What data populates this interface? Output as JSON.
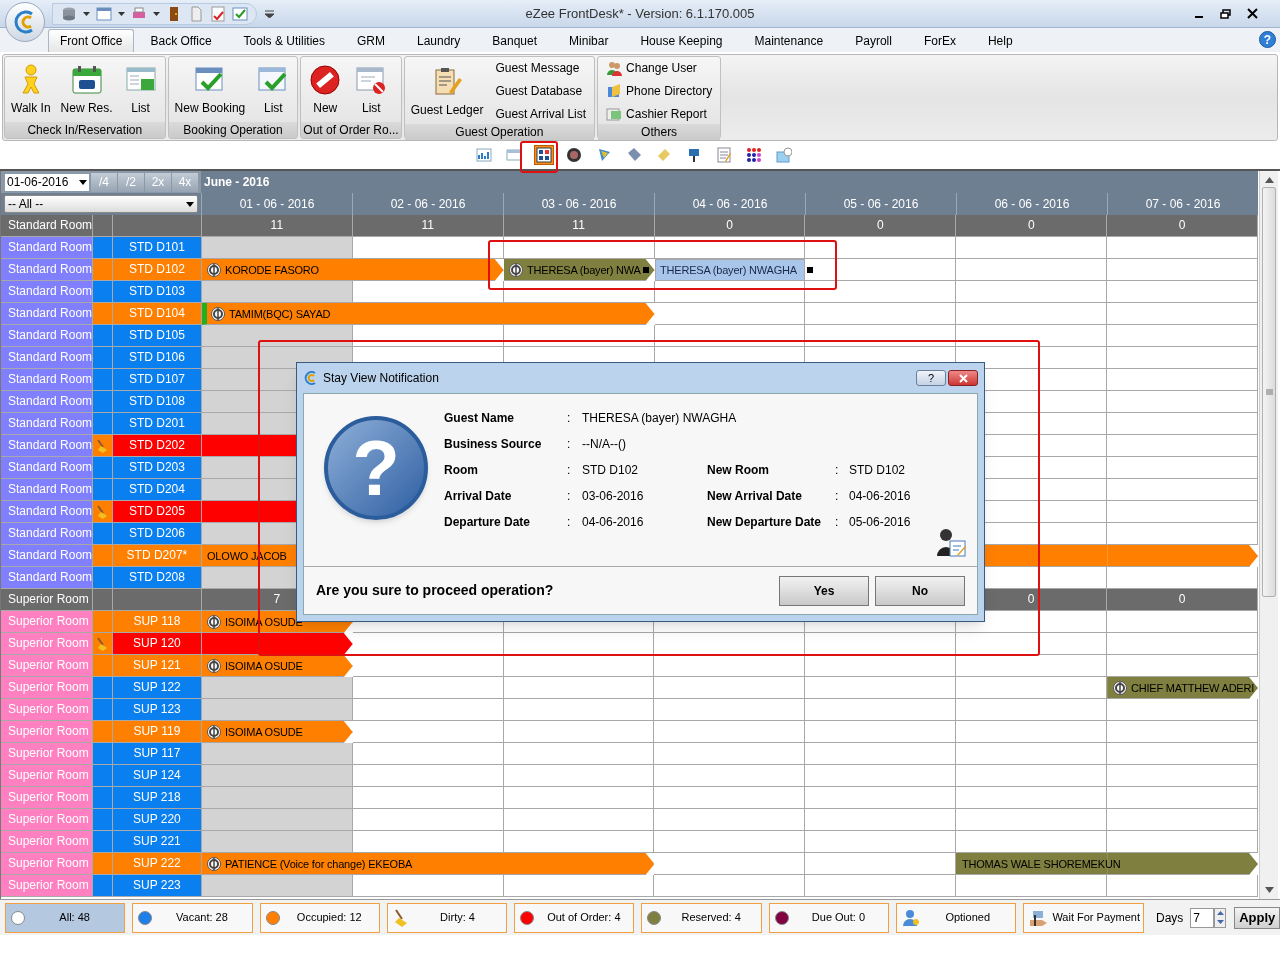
{
  "window": {
    "title": "eZee FrontDesk* - Version: 6.1.170.005"
  },
  "menu": {
    "tabs": [
      {
        "label": "Front Office",
        "selected": true
      },
      {
        "label": "Back Office",
        "selected": false
      },
      {
        "label": "Tools & Utilities",
        "selected": false
      },
      {
        "label": "GRM",
        "selected": false
      },
      {
        "label": "Laundry",
        "selected": false
      },
      {
        "label": "Banquet",
        "selected": false
      },
      {
        "label": "Minibar",
        "selected": false
      },
      {
        "label": "House Keeping",
        "selected": false
      },
      {
        "label": "Maintenance",
        "selected": false
      },
      {
        "label": "Payroll",
        "selected": false
      },
      {
        "label": "ForEx",
        "selected": false
      },
      {
        "label": "Help",
        "selected": false
      }
    ],
    "help_button": "?"
  },
  "ribbon": [
    {
      "label": "Check In/Reservation",
      "buttons": [
        {
          "label": "Walk In",
          "kind": "large"
        },
        {
          "label": "New Res.",
          "kind": "large"
        },
        {
          "label": "List",
          "kind": "large"
        }
      ]
    },
    {
      "label": "Booking Operation",
      "buttons": [
        {
          "label": "New Booking",
          "kind": "large"
        },
        {
          "label": "List",
          "kind": "large"
        }
      ]
    },
    {
      "label": "Out of Order Ro...",
      "buttons": [
        {
          "label": "New",
          "kind": "large"
        },
        {
          "label": "List",
          "kind": "large"
        }
      ]
    },
    {
      "label": "Guest Operation",
      "buttons": [
        {
          "label": "Guest Ledger",
          "kind": "large"
        },
        {
          "label": "Guest Message",
          "kind": "small"
        },
        {
          "label": "Guest Database",
          "kind": "small"
        },
        {
          "label": "Guest Arrival List",
          "kind": "small"
        }
      ]
    },
    {
      "label": "Others",
      "buttons": [
        {
          "label": "Change User",
          "kind": "small_icon"
        },
        {
          "label": "Phone Directory",
          "kind": "small_icon"
        },
        {
          "label": "Cashier Report",
          "kind": "small_icon"
        }
      ]
    }
  ],
  "view_toolbar": [
    {
      "selected": false
    },
    {
      "selected": false
    },
    {
      "selected": true
    },
    {
      "selected": false
    },
    {
      "selected": false
    },
    {
      "selected": false
    },
    {
      "selected": false
    },
    {
      "selected": false
    },
    {
      "selected": false
    },
    {
      "selected": false
    },
    {
      "selected": false
    }
  ],
  "stay_view": {
    "date": "01-06-2016",
    "zoom_buttons": [
      "/4",
      "/2",
      "2x",
      "4x"
    ],
    "month": "June - 2016",
    "filter": "-- All --",
    "dates": [
      "01 - 06 - 2016",
      "02 - 06 - 2016",
      "03 - 06 - 2016",
      "04 - 06 - 2016",
      "05 - 06 - 2016",
      "06 - 06 - 2016",
      "07 - 06 - 2016"
    ],
    "groups": [
      {
        "name": "Standard Room",
        "color": "#8080ff",
        "counts": [
          {
            "kind": "count",
            "value": "11"
          },
          {
            "kind": "count",
            "value": "11"
          },
          {
            "kind": "count",
            "value": "11"
          },
          {
            "kind": "count",
            "value": "0"
          },
          {
            "kind": "count",
            "value": "0"
          },
          {
            "kind": "count",
            "value": "0"
          },
          {
            "kind": "count",
            "value": "0"
          }
        ],
        "rooms": [
          {
            "type": "Standard Room",
            "room": "STD D101",
            "occupied": false,
            "out_of_order": false,
            "dirty": false,
            "cells": [
              {
                "kind": "empty"
              },
              {
                "kind": "empty"
              },
              {
                "kind": "empty"
              },
              {
                "kind": "empty"
              },
              {
                "kind": "empty"
              },
              {
                "kind": "empty"
              },
              {
                "kind": "empty"
              }
            ]
          },
          {
            "type": "Standard Room",
            "room": "STD D102",
            "occupied": true,
            "out_of_order": false,
            "dirty": false,
            "cells": [
              {
                "kind": "occupied"
              },
              {
                "kind": "occupied"
              },
              {
                "kind": "reserved"
              },
              {
                "kind": "moving"
              },
              {
                "kind": "empty"
              },
              {
                "kind": "empty"
              },
              {
                "kind": "empty"
              }
            ],
            "bookings": [
              {
                "label": "KORODE FASORO",
                "paid": true,
                "marked": false,
                "handle": false
              },
              {
                "label": "THERESA (bayer) NWA",
                "paid": true,
                "marked": false,
                "handle": true
              },
              {
                "label": "THERESA (bayer) NWAGHA",
                "paid": false,
                "marked": false,
                "handle": true
              }
            ]
          },
          {
            "type": "Standard Room",
            "room": "STD D103",
            "occupied": false,
            "out_of_order": false,
            "dirty": false,
            "cells": [
              {
                "kind": "empty"
              },
              {
                "kind": "empty"
              },
              {
                "kind": "empty"
              },
              {
                "kind": "empty"
              },
              {
                "kind": "empty"
              },
              {
                "kind": "empty"
              },
              {
                "kind": "empty"
              }
            ]
          },
          {
            "type": "Standard Room",
            "room": "STD D104",
            "occupied": true,
            "out_of_order": false,
            "dirty": false,
            "cells": [
              {
                "kind": "occupied"
              },
              {
                "kind": "occupied"
              },
              {
                "kind": "occupied"
              },
              {
                "kind": "empty"
              },
              {
                "kind": "empty"
              },
              {
                "kind": "empty"
              },
              {
                "kind": "empty"
              }
            ],
            "bookings": [
              {
                "label": "TAMIM(BQC) SAYAD",
                "paid": true,
                "marked": true,
                "handle": false
              }
            ]
          },
          {
            "type": "Standard Room",
            "room": "STD D105",
            "occupied": false,
            "out_of_order": false,
            "dirty": false,
            "cells": [
              {
                "kind": "empty"
              },
              {
                "kind": "empty"
              },
              {
                "kind": "empty"
              },
              {
                "kind": "empty"
              },
              {
                "kind": "empty"
              },
              {
                "kind": "empty"
              },
              {
                "kind": "empty"
              }
            ]
          },
          {
            "type": "Standard Room",
            "room": "STD D106",
            "occupied": false,
            "out_of_order": false,
            "dirty": false,
            "cells": [
              {
                "kind": "empty"
              },
              {
                "kind": "empty"
              },
              {
                "kind": "empty"
              },
              {
                "kind": "empty"
              },
              {
                "kind": "empty"
              },
              {
                "kind": "empty"
              },
              {
                "kind": "empty"
              }
            ]
          },
          {
            "type": "Standard Room",
            "room": "STD D107",
            "occupied": false,
            "out_of_order": false,
            "dirty": false,
            "cells": [
              {
                "kind": "empty"
              },
              {
                "kind": "covered"
              },
              {
                "kind": "covered"
              },
              {
                "kind": "covered"
              },
              {
                "kind": "covered"
              },
              {
                "kind": "empty"
              },
              {
                "kind": "empty"
              }
            ]
          },
          {
            "type": "Standard Room",
            "room": "STD D108",
            "occupied": false,
            "out_of_order": false,
            "dirty": false,
            "cells": [
              {
                "kind": "empty"
              },
              {
                "kind": "covered"
              },
              {
                "kind": "covered"
              },
              {
                "kind": "covered"
              },
              {
                "kind": "covered"
              },
              {
                "kind": "empty"
              },
              {
                "kind": "empty"
              }
            ]
          },
          {
            "type": "Standard Room",
            "room": "STD D201",
            "occupied": false,
            "out_of_order": false,
            "dirty": false,
            "cells": [
              {
                "kind": "empty"
              },
              {
                "kind": "covered"
              },
              {
                "kind": "covered"
              },
              {
                "kind": "covered"
              },
              {
                "kind": "covered"
              },
              {
                "kind": "empty"
              },
              {
                "kind": "empty"
              }
            ]
          },
          {
            "type": "Standard Room",
            "room": "STD D202",
            "occupied": false,
            "out_of_order": true,
            "dirty": true,
            "cells": [
              {
                "kind": "out_of_order"
              },
              {
                "kind": "covered"
              },
              {
                "kind": "covered"
              },
              {
                "kind": "covered"
              },
              {
                "kind": "covered"
              },
              {
                "kind": "empty"
              },
              {
                "kind": "empty"
              }
            ],
            "bookings": [
              {
                "paid": false,
                "marked": false,
                "handle": false
              }
            ]
          },
          {
            "type": "Standard Room",
            "room": "STD D203",
            "occupied": false,
            "out_of_order": false,
            "dirty": false,
            "cells": [
              {
                "kind": "empty"
              },
              {
                "kind": "covered"
              },
              {
                "kind": "covered"
              },
              {
                "kind": "covered"
              },
              {
                "kind": "covered"
              },
              {
                "kind": "empty"
              },
              {
                "kind": "empty"
              }
            ]
          },
          {
            "type": "Standard Room",
            "room": "STD D204",
            "occupied": false,
            "out_of_order": false,
            "dirty": false,
            "cells": [
              {
                "kind": "empty"
              },
              {
                "kind": "covered"
              },
              {
                "kind": "covered"
              },
              {
                "kind": "covered"
              },
              {
                "kind": "covered"
              },
              {
                "kind": "empty"
              },
              {
                "kind": "empty"
              }
            ]
          },
          {
            "type": "Standard Room",
            "room": "STD D205",
            "occupied": false,
            "out_of_order": true,
            "dirty": true,
            "cells": [
              {
                "kind": "out_of_order"
              },
              {
                "kind": "covered"
              },
              {
                "kind": "covered"
              },
              {
                "kind": "covered"
              },
              {
                "kind": "covered"
              },
              {
                "kind": "empty"
              },
              {
                "kind": "empty"
              }
            ],
            "bookings": [
              {
                "paid": false,
                "marked": false,
                "handle": false
              }
            ]
          },
          {
            "type": "Standard Room",
            "room": "STD D206",
            "occupied": false,
            "out_of_order": false,
            "dirty": false,
            "cells": [
              {
                "kind": "empty"
              },
              {
                "kind": "covered"
              },
              {
                "kind": "covered"
              },
              {
                "kind": "covered"
              },
              {
                "kind": "covered"
              },
              {
                "kind": "empty"
              },
              {
                "kind": "empty"
              }
            ]
          },
          {
            "type": "Standard Room",
            "room": "STD D207*",
            "occupied": true,
            "out_of_order": false,
            "dirty": false,
            "cells": [
              {
                "kind": "occupied"
              },
              {
                "kind": "covered"
              },
              {
                "kind": "covered"
              },
              {
                "kind": "covered"
              },
              {
                "kind": "covered"
              },
              {
                "kind": "occupied"
              },
              {
                "kind": "occupied"
              }
            ],
            "bookings": [
              {
                "label": "OLOWO JACOB",
                "paid": false,
                "marked": false,
                "handle": false
              }
            ]
          },
          {
            "type": "Standard Room",
            "room": "STD D208",
            "occupied": false,
            "out_of_order": false,
            "dirty": false,
            "cells": [
              {
                "kind": "empty"
              },
              {
                "kind": "covered"
              },
              {
                "kind": "covered"
              },
              {
                "kind": "covered"
              },
              {
                "kind": "covered"
              },
              {
                "kind": "empty"
              },
              {
                "kind": "empty"
              }
            ]
          }
        ]
      },
      {
        "name": "Superior Room",
        "color": "#ff80c0",
        "counts": [
          {
            "kind": "count",
            "value": "7"
          },
          {
            "kind": "blank"
          },
          {
            "kind": "blank"
          },
          {
            "kind": "blank"
          },
          {
            "kind": "blank"
          },
          {
            "kind": "count",
            "value": "0"
          },
          {
            "kind": "count",
            "value": "0"
          }
        ],
        "rooms": [
          {
            "type": "Superior Room",
            "room": "SUP 118",
            "occupied": true,
            "out_of_order": false,
            "dirty": false,
            "cells": [
              {
                "kind": "occupied"
              },
              {
                "kind": "empty"
              },
              {
                "kind": "empty"
              },
              {
                "kind": "empty"
              },
              {
                "kind": "empty"
              },
              {
                "kind": "empty"
              },
              {
                "kind": "empty"
              }
            ],
            "bookings": [
              {
                "label": "ISOIMA OSUDE",
                "paid": true,
                "marked": false,
                "handle": false
              }
            ]
          },
          {
            "type": "Superior Room",
            "room": "SUP 120",
            "occupied": false,
            "out_of_order": true,
            "dirty": true,
            "cells": [
              {
                "kind": "out_of_order"
              },
              {
                "kind": "empty"
              },
              {
                "kind": "empty"
              },
              {
                "kind": "empty"
              },
              {
                "kind": "empty"
              },
              {
                "kind": "empty"
              },
              {
                "kind": "empty"
              }
            ],
            "bookings": [
              {
                "paid": false,
                "marked": false,
                "handle": false
              }
            ]
          },
          {
            "type": "Superior Room",
            "room": "SUP 121",
            "occupied": true,
            "out_of_order": false,
            "dirty": false,
            "cells": [
              {
                "kind": "occupied"
              },
              {
                "kind": "empty"
              },
              {
                "kind": "empty"
              },
              {
                "kind": "empty"
              },
              {
                "kind": "empty"
              },
              {
                "kind": "empty"
              },
              {
                "kind": "empty"
              }
            ],
            "bookings": [
              {
                "label": "ISOIMA OSUDE",
                "paid": true,
                "marked": false,
                "handle": false
              }
            ]
          },
          {
            "type": "Superior Room",
            "room": "SUP 122",
            "occupied": false,
            "out_of_order": false,
            "dirty": false,
            "cells": [
              {
                "kind": "empty"
              },
              {
                "kind": "empty"
              },
              {
                "kind": "empty"
              },
              {
                "kind": "empty"
              },
              {
                "kind": "empty"
              },
              {
                "kind": "empty"
              },
              {
                "kind": "reserved"
              }
            ],
            "bookings": [
              {
                "label": "CHIEF MATTHEW ADERI",
                "paid": true,
                "marked": false,
                "handle": false
              }
            ]
          },
          {
            "type": "Superior Room",
            "room": "SUP 123",
            "occupied": false,
            "out_of_order": false,
            "dirty": false,
            "cells": [
              {
                "kind": "empty"
              },
              {
                "kind": "empty"
              },
              {
                "kind": "empty"
              },
              {
                "kind": "empty"
              },
              {
                "kind": "empty"
              },
              {
                "kind": "empty"
              },
              {
                "kind": "empty"
              }
            ]
          },
          {
            "type": "Superior Room",
            "room": "SUP 119",
            "occupied": true,
            "out_of_order": false,
            "dirty": false,
            "cells": [
              {
                "kind": "occupied"
              },
              {
                "kind": "empty"
              },
              {
                "kind": "empty"
              },
              {
                "kind": "empty"
              },
              {
                "kind": "empty"
              },
              {
                "kind": "empty"
              },
              {
                "kind": "empty"
              }
            ],
            "bookings": [
              {
                "label": "ISOIMA OSUDE",
                "paid": true,
                "marked": false,
                "handle": false
              }
            ]
          },
          {
            "type": "Superior Room",
            "room": "SUP 117",
            "occupied": false,
            "out_of_order": false,
            "dirty": false,
            "cells": [
              {
                "kind": "empty"
              },
              {
                "kind": "empty"
              },
              {
                "kind": "empty"
              },
              {
                "kind": "empty"
              },
              {
                "kind": "empty"
              },
              {
                "kind": "empty"
              },
              {
                "kind": "empty"
              }
            ]
          },
          {
            "type": "Superior Room",
            "room": "SUP 124",
            "occupied": false,
            "out_of_order": false,
            "dirty": false,
            "cells": [
              {
                "kind": "empty"
              },
              {
                "kind": "empty"
              },
              {
                "kind": "empty"
              },
              {
                "kind": "empty"
              },
              {
                "kind": "empty"
              },
              {
                "kind": "empty"
              },
              {
                "kind": "empty"
              }
            ]
          },
          {
            "type": "Superior Room",
            "room": "SUP 218",
            "occupied": false,
            "out_of_order": false,
            "dirty": false,
            "cells": [
              {
                "kind": "empty"
              },
              {
                "kind": "empty"
              },
              {
                "kind": "empty"
              },
              {
                "kind": "empty"
              },
              {
                "kind": "empty"
              },
              {
                "kind": "empty"
              },
              {
                "kind": "empty"
              }
            ]
          },
          {
            "type": "Superior Room",
            "room": "SUP 220",
            "occupied": false,
            "out_of_order": false,
            "dirty": false,
            "cells": [
              {
                "kind": "empty"
              },
              {
                "kind": "empty"
              },
              {
                "kind": "empty"
              },
              {
                "kind": "empty"
              },
              {
                "kind": "empty"
              },
              {
                "kind": "empty"
              },
              {
                "kind": "empty"
              }
            ]
          },
          {
            "type": "Superior Room",
            "room": "SUP 221",
            "occupied": false,
            "out_of_order": false,
            "dirty": false,
            "cells": [
              {
                "kind": "empty"
              },
              {
                "kind": "empty"
              },
              {
                "kind": "empty"
              },
              {
                "kind": "empty"
              },
              {
                "kind": "empty"
              },
              {
                "kind": "empty"
              },
              {
                "kind": "empty"
              }
            ]
          },
          {
            "type": "Superior Room",
            "room": "SUP 222",
            "occupied": true,
            "out_of_order": false,
            "dirty": false,
            "cells": [
              {
                "kind": "occupied"
              },
              {
                "kind": "occupied"
              },
              {
                "kind": "occupied"
              },
              {
                "kind": "empty"
              },
              {
                "kind": "empty"
              },
              {
                "kind": "reserved"
              },
              {
                "kind": "reserved"
              }
            ],
            "bookings": [
              {
                "label": "PATIENCE (Voice for change) EKEOBA",
                "paid": true,
                "marked": false,
                "handle": false
              },
              {
                "label": "THOMAS WALE SHOREMEKUN",
                "paid": false,
                "marked": false,
                "handle": false
              }
            ]
          },
          {
            "type": "Superior Room",
            "room": "SUP 223",
            "occupied": false,
            "out_of_order": false,
            "dirty": false,
            "cells": [
              {
                "kind": "empty"
              },
              {
                "kind": "empty"
              },
              {
                "kind": "empty"
              },
              {
                "kind": "empty"
              },
              {
                "kind": "empty"
              },
              {
                "kind": "empty"
              },
              {
                "kind": "empty"
              }
            ]
          }
        ]
      }
    ]
  },
  "dialog": {
    "title": "Stay View Notification",
    "help_button": "?",
    "symbol": "?",
    "fields": [
      {
        "label": "Guest Name",
        "separator": ":",
        "value": "THERESA (bayer) NWAGHA"
      },
      {
        "label": "Business Source",
        "separator": ":",
        "value": "--N/A--()"
      },
      {
        "label": "Room",
        "separator": ":",
        "value": "STD D102",
        "new_label": "New Room",
        "new_separator": ":",
        "new_value": "STD D102"
      },
      {
        "label": "Arrival Date",
        "separator": ":",
        "value": "03-06-2016",
        "new_label": "New Arrival Date",
        "new_separator": ":",
        "new_value": "04-06-2016"
      },
      {
        "label": "Departure Date",
        "separator": ":",
        "value": "04-06-2016",
        "new_label": "New Departure Date",
        "new_separator": ":",
        "new_value": "05-06-2016"
      }
    ],
    "question": "Are you sure to proceed operation?",
    "buttons": [
      "Yes",
      "No"
    ]
  },
  "legend": [
    {
      "label": "All: 48",
      "kind": "dot",
      "color": "#ffffff",
      "selected": true
    },
    {
      "label": "Vacant: 28",
      "kind": "dot",
      "color": "#1e7fe8",
      "selected": false
    },
    {
      "label": "Occupied: 12",
      "kind": "dot",
      "color": "#ff8000",
      "selected": false
    },
    {
      "label": "Dirty: 4",
      "kind": "broom",
      "selected": false
    },
    {
      "label": "Out of Order: 4",
      "kind": "dot",
      "color": "#ff0000",
      "selected": false
    },
    {
      "label": "Reserved: 4",
      "kind": "dot",
      "color": "#7f7f3f",
      "selected": false
    },
    {
      "label": "Due Out: 0",
      "kind": "dot",
      "color": "#800040",
      "selected": false
    },
    {
      "label": "Optioned",
      "kind": "person",
      "selected": false
    },
    {
      "label": "Wait For Payment",
      "kind": "payment",
      "selected": false
    }
  ],
  "days": {
    "label": "Days",
    "value": "7"
  },
  "apply_button": "Apply"
}
